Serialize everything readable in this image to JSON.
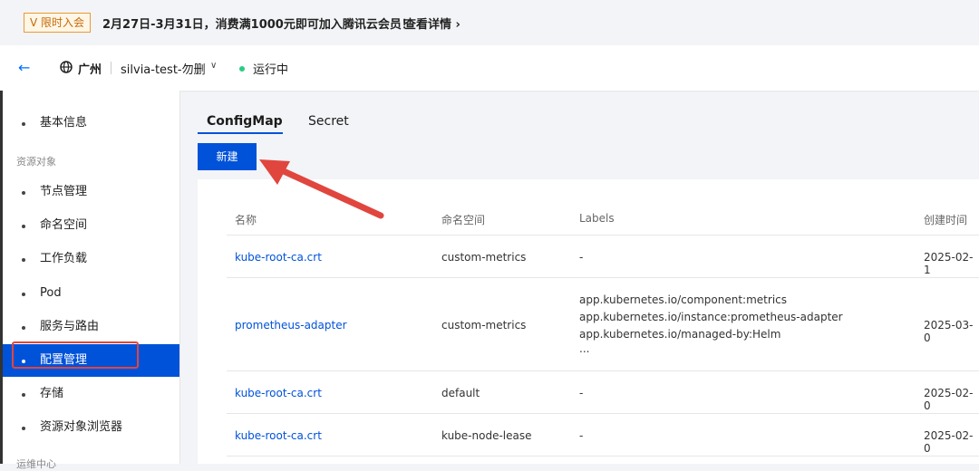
{
  "promo": {
    "badge": "V 限时入会",
    "text": "2月27日-3月31日，消费满1000元即可加入腾讯云会员！",
    "link": "查看详情 ›"
  },
  "header": {
    "back_icon": "arrow-left-icon",
    "region": "广州",
    "cluster_name": "silvia-test-勿删",
    "status": "运行中",
    "status_color": "#29cc85"
  },
  "sidebar": {
    "items_top": [
      {
        "label": "基本信息"
      }
    ],
    "group_label": "资源对象",
    "items": [
      {
        "label": "节点管理"
      },
      {
        "label": "命名空间"
      },
      {
        "label": "工作负载"
      },
      {
        "label": "Pod"
      },
      {
        "label": "服务与路由"
      },
      {
        "label": "配置管理",
        "active": true
      },
      {
        "label": "存储"
      },
      {
        "label": "资源对象浏览器"
      }
    ],
    "group_label_2": "运维中心"
  },
  "tabs": [
    {
      "label": "ConfigMap",
      "active": true
    },
    {
      "label": "Secret"
    }
  ],
  "new_button": "新建",
  "table": {
    "headers": [
      "名称",
      "命名空间",
      "Labels",
      "创建时间"
    ],
    "rows": [
      {
        "name": "kube-root-ca.crt",
        "namespace": "custom-metrics",
        "labels": [
          "-"
        ],
        "created": "2025-02-1"
      },
      {
        "name": "prometheus-adapter",
        "namespace": "custom-metrics",
        "labels": [
          "app.kubernetes.io/component:metrics",
          "app.kubernetes.io/instance:prometheus-adapter",
          "app.kubernetes.io/managed-by:Helm",
          "..."
        ],
        "created": "2025-03-0"
      },
      {
        "name": "kube-root-ca.crt",
        "namespace": "default",
        "labels": [
          "-"
        ],
        "created": "2025-02-0"
      },
      {
        "name": "kube-root-ca.crt",
        "namespace": "kube-node-lease",
        "labels": [
          "-"
        ],
        "created": "2025-02-0"
      }
    ]
  },
  "colors": {
    "primary": "#0052d9",
    "annotation": "#e0463e"
  }
}
